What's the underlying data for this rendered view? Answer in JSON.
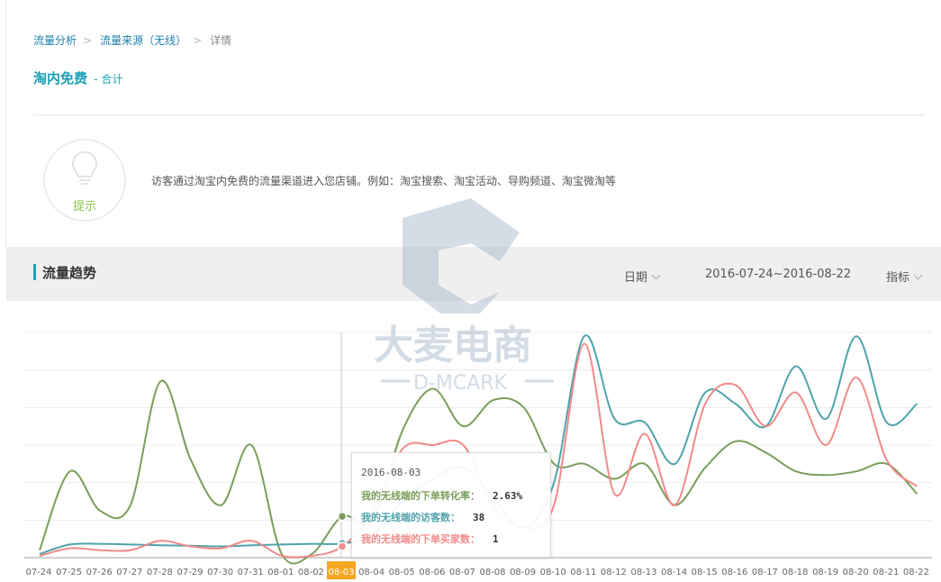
{
  "breadcrumb": {
    "items": [
      "流量分析",
      "流量来源（无线）",
      "详情"
    ]
  },
  "page_title": {
    "main": "淘内免费",
    "sub": "- 合计"
  },
  "tip": {
    "label": "提示",
    "text": "访客通过淘宝内免费的流量渠道进入您店铺。例如：淘宝搜索、淘宝活动、导购频道、淘宝微淘等"
  },
  "trend": {
    "title": "流量趋势",
    "date_label": "日期",
    "date_range": "2016-07-24~2016-08-22",
    "metric_label": "指标"
  },
  "tooltip": {
    "date": "2016-08-03",
    "rows": [
      {
        "label": "我的无线端的下单转化率：",
        "value": "2.63%"
      },
      {
        "label": "我的无线端的访客数：",
        "value": "38"
      },
      {
        "label": "我的无线端的下单买家数：",
        "value": "1"
      }
    ]
  },
  "watermark": {
    "text": "大麦电商",
    "sub": "D-MCARK"
  },
  "colors": {
    "conversion": "#7a9e5a",
    "visitors": "#4fa3ab",
    "buyers": "#f08a8a",
    "highlight": "#f5a623"
  },
  "chart_data": {
    "type": "line",
    "x": [
      "07-24",
      "07-25",
      "07-26",
      "07-27",
      "07-28",
      "07-29",
      "07-30",
      "07-31",
      "08-01",
      "08-02",
      "08-03",
      "08-04",
      "08-05",
      "08-06",
      "08-07",
      "08-08",
      "08-09",
      "08-10",
      "08-11",
      "08-12",
      "08-13",
      "08-14",
      "08-15",
      "08-16",
      "08-17",
      "08-18",
      "08-19",
      "08-20",
      "08-21",
      "08-22"
    ],
    "highlight_index": 10,
    "ylim": [
      0,
      6
    ],
    "grid": true,
    "series": [
      {
        "name": "我的无线端的下单转化率",
        "color": "#7a9e5a",
        "values": [
          0.2,
          2.3,
          1.25,
          1.4,
          4.7,
          2.6,
          1.4,
          3.0,
          0.1,
          0.1,
          1.1,
          1.0,
          3.4,
          4.5,
          3.5,
          4.2,
          4.0,
          2.5,
          2.5,
          2.1,
          2.5,
          1.4,
          2.4,
          3.1,
          2.8,
          2.3,
          2.2,
          2.3,
          2.5,
          1.7
        ]
      },
      {
        "name": "我的无线端的访客数",
        "color": "#4fa3ab",
        "values": [
          0.1,
          0.35,
          0.37,
          0.35,
          0.33,
          0.32,
          0.3,
          0.33,
          0.35,
          0.37,
          0.38,
          0.6,
          1.5,
          2.1,
          2.4,
          1.6,
          0.8,
          2.0,
          5.9,
          3.7,
          3.6,
          2.5,
          4.4,
          4.1,
          3.5,
          5.1,
          3.7,
          5.9,
          3.6,
          4.1
        ]
      },
      {
        "name": "我的无线端的下单买家数",
        "color": "#f08a8a",
        "values": [
          0.05,
          0.25,
          0.2,
          0.2,
          0.45,
          0.3,
          0.25,
          0.45,
          0.05,
          0.05,
          0.3,
          1.2,
          2.9,
          3.0,
          3.0,
          1.4,
          0.8,
          1.4,
          5.7,
          1.7,
          3.3,
          1.4,
          4.1,
          4.6,
          3.5,
          4.4,
          3.0,
          4.8,
          2.6,
          1.9
        ]
      }
    ]
  }
}
